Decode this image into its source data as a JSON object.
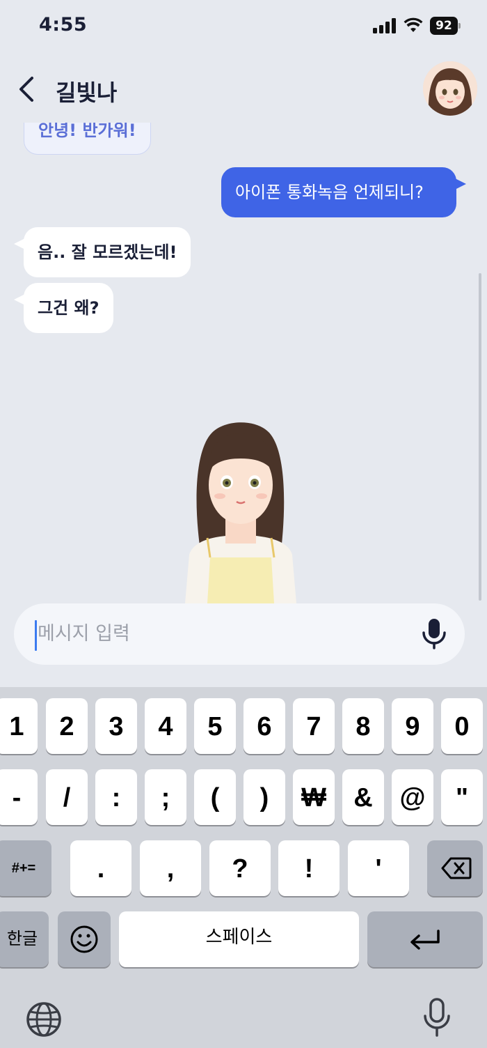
{
  "status_bar": {
    "time": "4:55",
    "battery": "92"
  },
  "header": {
    "title": "길빛나"
  },
  "messages": [
    {
      "from": "bot",
      "text": "안녕! 반가워!"
    },
    {
      "from": "user",
      "text": "아이폰 통화녹음 언제되니?"
    },
    {
      "from": "bot",
      "text": "음.. 잘 모르겠는데!"
    },
    {
      "from": "bot",
      "text": "그건 왜?"
    }
  ],
  "input": {
    "placeholder": "메시지 입력"
  },
  "keyboard": {
    "row1": [
      "1",
      "2",
      "3",
      "4",
      "5",
      "6",
      "7",
      "8",
      "9",
      "0"
    ],
    "row2": [
      "-",
      "/",
      ":",
      ";",
      "(",
      ")",
      "₩",
      "&",
      "@",
      "\""
    ],
    "row3_toggle": "#+=",
    "row3": [
      ".",
      ",",
      "?",
      "!",
      "'"
    ],
    "lang_key": "한글",
    "space_label": "스페이스"
  },
  "colors": {
    "accent": "#3f64e6",
    "bubble_in": "#ffffff",
    "background": "#e6e9ef"
  }
}
